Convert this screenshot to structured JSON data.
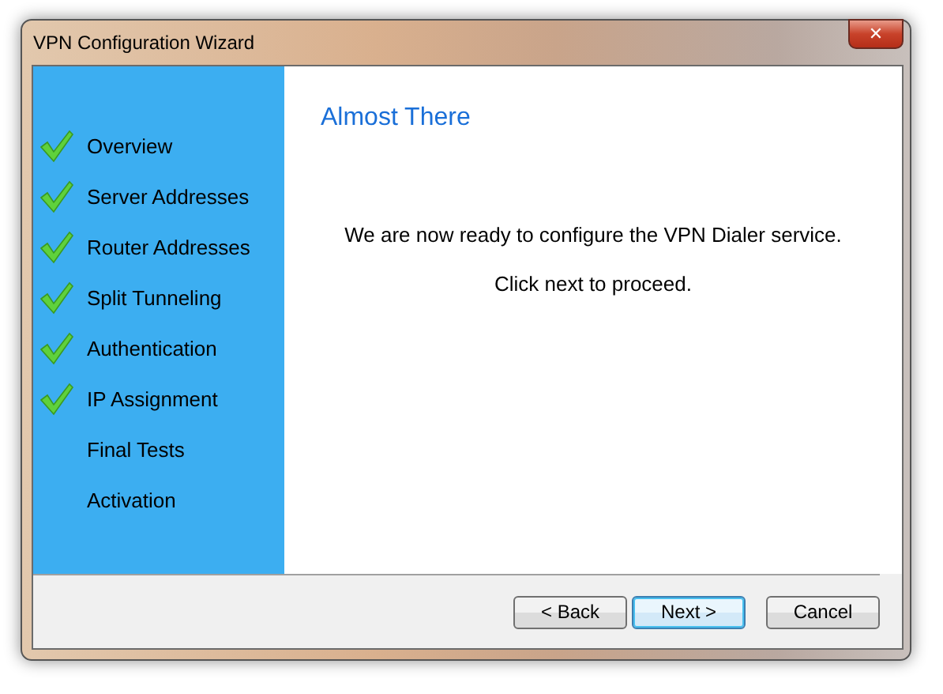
{
  "window": {
    "title": "VPN Configuration Wizard",
    "close": "✕"
  },
  "steps": [
    {
      "label": "Overview",
      "completed": true
    },
    {
      "label": "Server Addresses",
      "completed": true
    },
    {
      "label": "Router Addresses",
      "completed": true
    },
    {
      "label": "Split Tunneling",
      "completed": true
    },
    {
      "label": "Authentication",
      "completed": true
    },
    {
      "label": "IP Assignment",
      "completed": true
    },
    {
      "label": "Final Tests",
      "completed": false
    },
    {
      "label": "Activation",
      "completed": false
    }
  ],
  "page": {
    "heading": "Almost There",
    "messages": [
      "We are now ready to configure the VPN Dialer service.",
      "Click next to proceed."
    ]
  },
  "buttons": [
    {
      "label": "< Back",
      "default": false
    },
    {
      "label": "Next >",
      "default": true
    },
    {
      "label": "Cancel",
      "default": false
    }
  ]
}
